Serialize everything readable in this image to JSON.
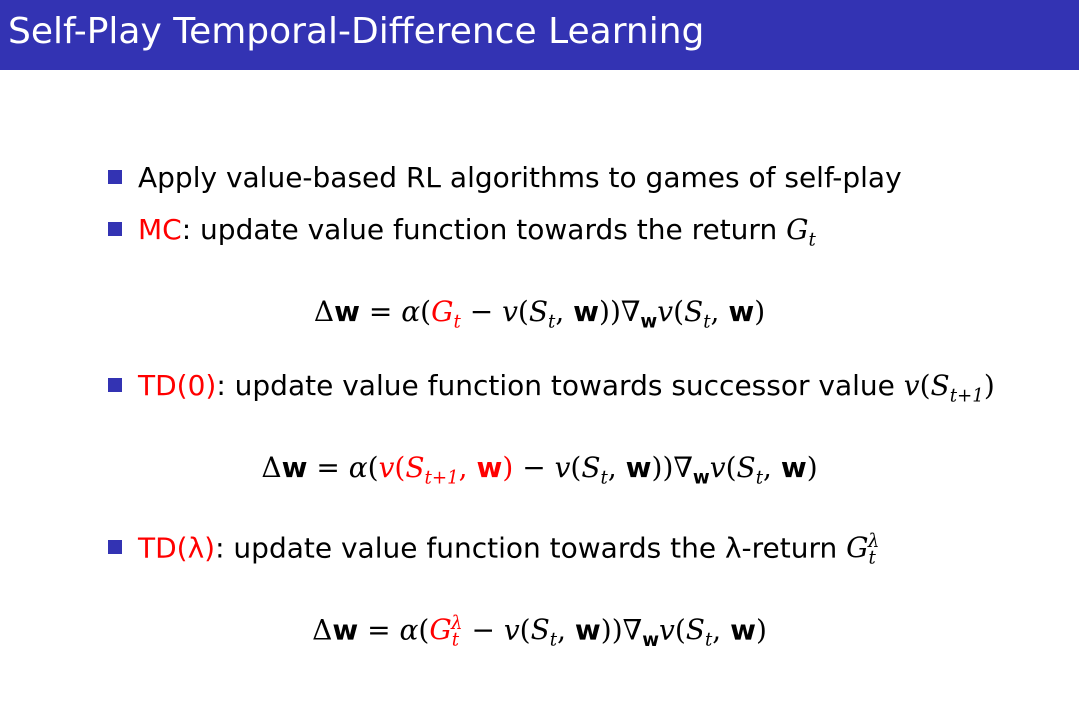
{
  "title": "Self-Play Temporal-Difference Learning",
  "bullets": [
    {
      "text": "Apply value-based RL algorithms to games of self-play"
    },
    {
      "label": "MC",
      "text": ": update value function towards the return "
    },
    {
      "label": "TD(0)",
      "text": ": update value function towards successor value "
    },
    {
      "label": "TD(λ)",
      "text": ": update value function towards the λ-return "
    }
  ],
  "colors": {
    "title_bar": "#3333b3",
    "bullet": "#3333b3",
    "highlight": "#ff0000"
  }
}
